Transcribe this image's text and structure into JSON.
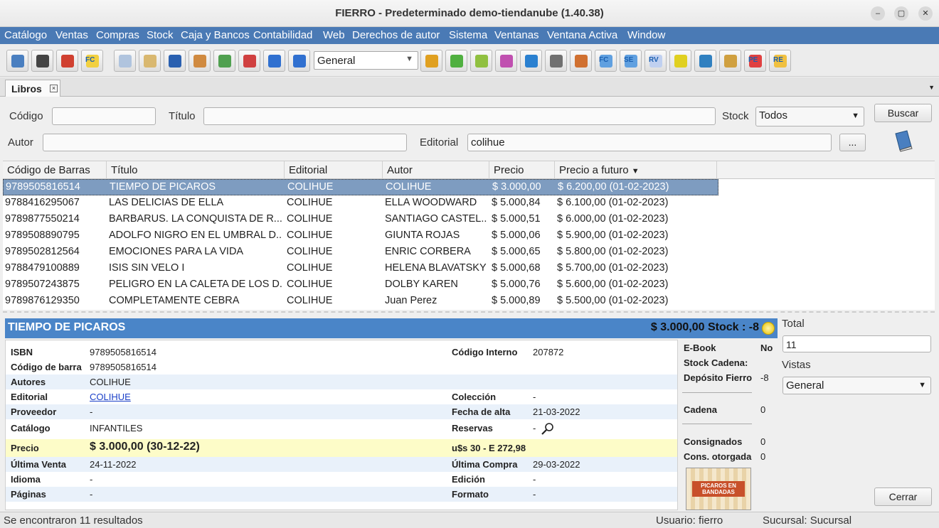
{
  "window": {
    "title": "FIERRO - Predeterminado demo-tiendanube (1.40.38)",
    "minimize": "–",
    "restore": "▢",
    "close": "✕"
  },
  "menu": [
    "Catálogo",
    "Ventas",
    "Compras",
    "Stock",
    "Caja y Bancos",
    "Contabilidad",
    "Web",
    "Derechos de autor",
    "Sistema",
    "Ventanas",
    "Ventana Activa",
    "Window"
  ],
  "toolbar": {
    "view_select": "General",
    "buttons": [
      {
        "icon": "book-icon",
        "color": "#4a7fc0"
      },
      {
        "icon": "barcode-icon",
        "color": "#444444"
      },
      {
        "icon": "truck-icon",
        "color": "#d04030"
      },
      {
        "icon": "fc-icon",
        "color": "#f2d040",
        "text": "FC"
      },
      {
        "icon": "document-icon",
        "color": "#b0c4de"
      },
      {
        "icon": "note-icon",
        "color": "#d9b870"
      },
      {
        "icon": "shield-icon",
        "color": "#2a60b0"
      },
      {
        "icon": "scroll-icon",
        "color": "#d08a40"
      },
      {
        "icon": "check-icon",
        "color": "#50a050"
      },
      {
        "icon": "cross-icon",
        "color": "#d04040"
      },
      {
        "icon": "list-icon",
        "color": "#3070d0"
      },
      {
        "icon": "list-alt-icon",
        "color": "#3070d0"
      }
    ],
    "buttons_right": [
      {
        "icon": "rings-icon",
        "color": "#e0a020"
      },
      {
        "icon": "circle-icon",
        "color": "#50b040"
      },
      {
        "icon": "link-icon",
        "color": "#90c040"
      },
      {
        "icon": "eraser-icon",
        "color": "#c050b0"
      },
      {
        "icon": "search-doc-icon",
        "color": "#2a80d0"
      },
      {
        "icon": "printer-icon",
        "color": "#707070"
      },
      {
        "icon": "store-icon",
        "color": "#d07030"
      },
      {
        "icon": "fc-window-icon",
        "color": "#60a0e0",
        "text": "FC"
      },
      {
        "icon": "se-icon",
        "color": "#60a0e0",
        "text": "SE"
      },
      {
        "icon": "rv-icon",
        "color": "#c0d0f0",
        "text": "RV"
      },
      {
        "icon": "book-yellow-icon",
        "color": "#e0d020"
      },
      {
        "icon": "drop-icon",
        "color": "#3080c0"
      },
      {
        "icon": "box-icon",
        "color": "#d0a040"
      },
      {
        "icon": "pe-icon",
        "color": "#e04040",
        "text": "PE"
      },
      {
        "icon": "re-icon",
        "color": "#f0c040",
        "text": "RE"
      }
    ]
  },
  "tab": {
    "label": "Libros"
  },
  "filters": {
    "codigo_label": "Código",
    "codigo_value": "",
    "titulo_label": "Título",
    "titulo_value": "",
    "stock_label": "Stock",
    "stock_value": "Todos",
    "autor_label": "Autor",
    "autor_value": "",
    "editorial_label": "Editorial",
    "editorial_value": "colihue",
    "buscar": "Buscar",
    "dots": "..."
  },
  "table": {
    "columns": [
      "Código de Barras",
      "Título",
      "Editorial",
      "Autor",
      "Precio",
      "Precio a futuro"
    ],
    "sort_indicator": "▼",
    "rows": [
      [
        "9789505816514",
        "TIEMPO DE PICAROS",
        "COLIHUE",
        "COLIHUE",
        "$ 3.000,00",
        "$ 6.200,00 (01-02-2023)"
      ],
      [
        "9788416295067",
        "LAS DELICIAS DE ELLA",
        "COLIHUE",
        "ELLA WOODWARD",
        "$ 5.000,84",
        "$ 6.100,00 (01-02-2023)"
      ],
      [
        "9789877550214",
        "BARBARUS. LA CONQUISTA DE R...",
        "COLIHUE",
        "SANTIAGO CASTEL...",
        "$ 5.000,51",
        "$ 6.000,00 (01-02-2023)"
      ],
      [
        "9789508890795",
        "ADOLFO NIGRO EN EL UMBRAL D...",
        "COLIHUE",
        "GIUNTA ROJAS",
        "$ 5.000,06",
        "$ 5.900,00 (01-02-2023)"
      ],
      [
        "9789502812564",
        "EMOCIONES PARA LA VIDA",
        "COLIHUE",
        "ENRIC CORBERA",
        "$ 5.000,65",
        "$ 5.800,00 (01-02-2023)"
      ],
      [
        "9788479100889",
        "ISIS SIN VELO I",
        "COLIHUE",
        "HELENA BLAVATSKY",
        "$ 5.000,68",
        "$ 5.700,00 (01-02-2023)"
      ],
      [
        "9789507243875",
        "PELIGRO EN LA CALETA DE LOS D...",
        "COLIHUE",
        "DOLBY KAREN",
        "$ 5.000,76",
        "$ 5.600,00 (01-02-2023)"
      ],
      [
        "9789876129350",
        "COMPLETAMENTE CEBRA",
        "COLIHUE",
        "Juan Perez",
        "$ 5.000,89",
        "$ 5.500,00 (01-02-2023)"
      ]
    ]
  },
  "detail": {
    "title": "TIEMPO DE PICAROS",
    "price_stock": "$ 3.000,00 Stock : -8",
    "fields": {
      "isbn_k": "ISBN",
      "isbn_v": "9789505816514",
      "codigo_interno_k": "Código Interno",
      "codigo_interno_v": "207872",
      "codigo_barra_k": "Código de barra",
      "codigo_barra_v": "9789505816514",
      "autores_k": "Autores",
      "autores_v": "COLIHUE",
      "editorial_k": "Editorial",
      "editorial_v": "COLIHUE",
      "coleccion_k": "Colección",
      "coleccion_v": "-",
      "proveedor_k": "Proveedor",
      "proveedor_v": "-",
      "fecha_alta_k": "Fecha de alta",
      "fecha_alta_v": "21-03-2022",
      "catalogo_k": "Catálogo",
      "catalogo_v": "INFANTILES",
      "reservas_k": "Reservas",
      "reservas_v": "-",
      "precio_k": "Precio",
      "precio_v": "$ 3.000,00 (30-12-22)",
      "precio_usd": "u$s 30 - E 272,98",
      "ultima_venta_k": "Última Venta",
      "ultima_venta_v": "24-11-2022",
      "ultima_compra_k": "Última Compra",
      "ultima_compra_v": "29-03-2022",
      "idioma_k": "Idioma",
      "idioma_v": "-",
      "edicion_k": "Edición",
      "edicion_v": "-",
      "paginas_k": "Páginas",
      "paginas_v": "-",
      "formato_k": "Formato",
      "formato_v": "-"
    },
    "side": {
      "ebook_k": "E-Book",
      "ebook_v": "No",
      "stock_cadena_k": "Stock Cadena:",
      "deposito_k": "Depósito Fierro",
      "deposito_v": "-8",
      "cadena_k": "Cadena",
      "cadena_v": "0",
      "consignados_k": "Consignados",
      "consignados_v": "0",
      "cons_otorgada_k": "Cons. otorgada",
      "cons_otorgada_v": "0"
    },
    "cover_text": "PICAROS EN BANDADAS"
  },
  "right_panel": {
    "total_label": "Total",
    "total_value": "11",
    "vistas_label": "Vistas",
    "vistas_value": "General",
    "cerrar": "Cerrar"
  },
  "status": {
    "results": "Se encontraron 11 resultados",
    "usuario": "Usuario: fierro",
    "sucursal": "Sucursal: Sucursal"
  }
}
